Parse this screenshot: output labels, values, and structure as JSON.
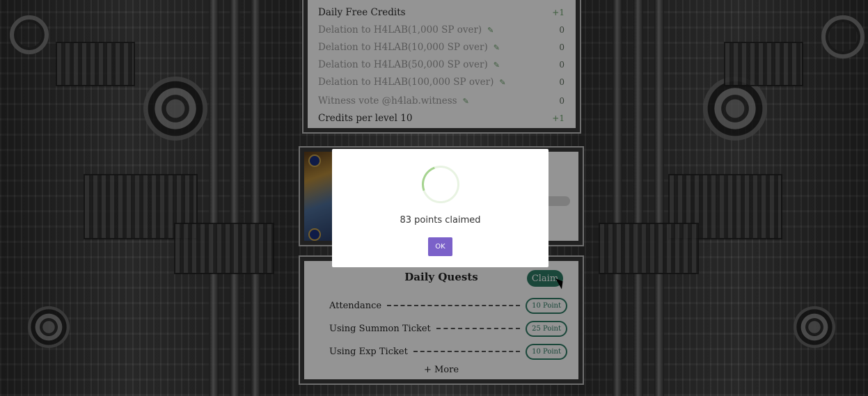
{
  "credits": {
    "rows": [
      {
        "label": "Daily Free Credits",
        "value": "+1",
        "muted": false,
        "has_icon": false
      },
      {
        "label": "Delation to H4LAB(1,000 SP over)",
        "value": "0",
        "muted": true,
        "has_icon": true
      },
      {
        "label": "Delation to H4LAB(10,000 SP over)",
        "value": "0",
        "muted": true,
        "has_icon": true
      },
      {
        "label": "Delation to H4LAB(50,000 SP over)",
        "value": "0",
        "muted": true,
        "has_icon": true
      },
      {
        "label": "Delation to H4LAB(100,000 SP over)",
        "value": "0",
        "muted": true,
        "has_icon": true
      },
      {
        "label": "Witness vote @h4lab.witness",
        "value": "0",
        "muted": true,
        "has_icon": true
      },
      {
        "label": "Credits per level 10",
        "value": "+1",
        "muted": false,
        "has_icon": false
      }
    ]
  },
  "quests": {
    "title": "Daily Quests",
    "claim_label": "Claim",
    "items": [
      {
        "label": "Attendance",
        "points": "10 Point"
      },
      {
        "label": "Using Summon Ticket",
        "points": "25 Point"
      },
      {
        "label": "Using Exp Ticket",
        "points": "10 Point"
      }
    ],
    "more_label": "+ More"
  },
  "modal": {
    "message": "83 points claimed",
    "ok_label": "OK"
  },
  "icons": {
    "edit": "pencil-icon",
    "spinner": "loading-spinner-icon",
    "cursor": "mouse-cursor-icon"
  },
  "colors": {
    "accent_green": "#2e7a64",
    "ok_button": "#7b61c9",
    "spinner": "#a5d38f"
  }
}
